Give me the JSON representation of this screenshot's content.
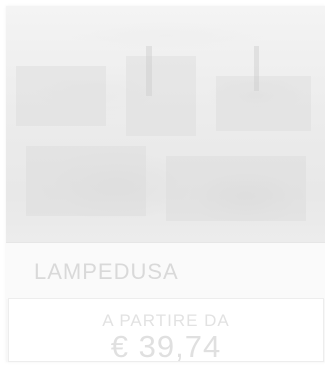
{
  "card": {
    "city": "LAMPEDUSA",
    "price_prefix": "A PARTIRE DA",
    "price": "€ 39,74"
  },
  "icons": {
    "photo": "city-photo"
  }
}
